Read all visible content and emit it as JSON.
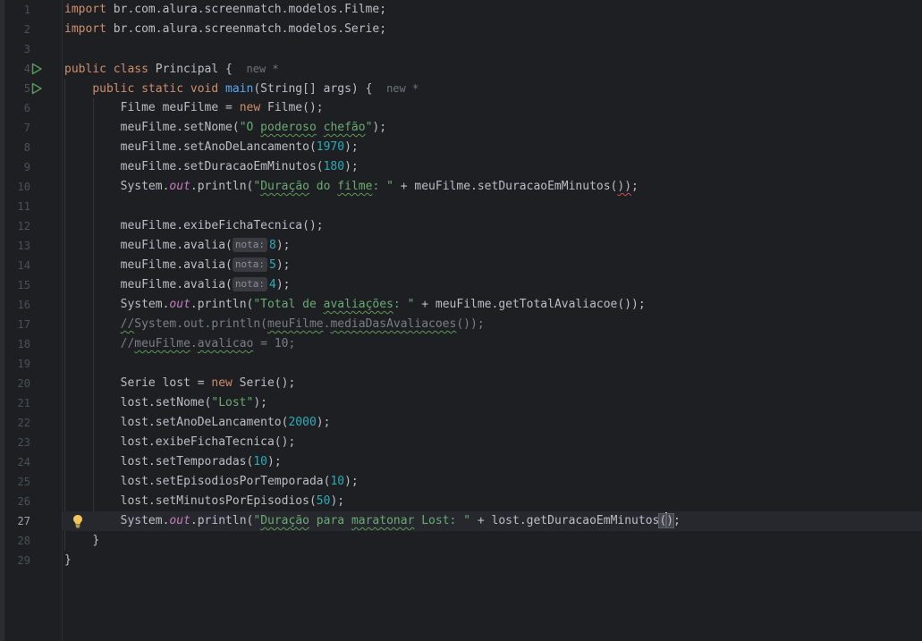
{
  "gutter": {
    "line_numbers": [
      "1",
      "2",
      "3",
      "4",
      "5",
      "6",
      "7",
      "8",
      "9",
      "10",
      "11",
      "12",
      "13",
      "14",
      "15",
      "16",
      "17",
      "18",
      "19",
      "20",
      "21",
      "22",
      "23",
      "24",
      "25",
      "26",
      "27",
      "28",
      "29"
    ],
    "current_line": "27"
  },
  "hints": {
    "new_label": "new *"
  },
  "code": {
    "l1a": "import",
    "l1b": " br.com.alura.screenmatch.modelos.Filme;",
    "l2a": "import",
    "l2b": " br.com.alura.screenmatch.modelos.Serie;",
    "l4a": "public class",
    "l4b": " Principal {",
    "l5a": "public static void",
    "l5b": "main",
    "l5c": "(String[] args) {",
    "l6a": "Filme meuFilme = ",
    "l6b": "new",
    "l6c": " Filme();",
    "l7a": "meuFilme.setNome(",
    "l7b": "\"O ",
    "l7c": "poderoso",
    "l7d": " ",
    "l7e": "chefão",
    "l7f": "\"",
    "l7g": ");",
    "l8a": "meuFilme.setAnoDeLancamento(",
    "l8b": "1970",
    "l8c": ");",
    "l9a": "meuFilme.setDuracaoEmMinutos(",
    "l9b": "180",
    "l9c": ");",
    "l10a": "System.",
    "l10b": "out",
    "l10c": ".println(",
    "l10d": "\"",
    "l10e": "Duração",
    "l10f": " do ",
    "l10g": "filme",
    "l10h": ": \"",
    "l10i": " + meuFilme.setDuracaoEmMinutos(",
    "l10j": "))",
    "l10k": ";",
    "l12a": "meuFilme.exibeFichaTecnica();",
    "l13a": "meuFilme.avalia(",
    "l13b": "nota:",
    "l13c": "8",
    "l13d": ");",
    "l14a": "meuFilme.avalia(",
    "l14b": "nota:",
    "l14c": "5",
    "l14d": ");",
    "l15a": "meuFilme.avalia(",
    "l15b": "nota:",
    "l15c": "4",
    "l15d": ");",
    "l16a": "System.",
    "l16b": "out",
    "l16c": ".println(",
    "l16d": "\"Total de ",
    "l16e": "avaliações",
    "l16f": ": \"",
    "l16g": " + meuFilme.getTotalAvaliacoe());",
    "l17a": "//",
    "l17b": "System.out.println(",
    "l17c": "meuFilme",
    "l17d": ".",
    "l17e": "mediaDasAvaliacoes",
    "l17f": "());",
    "l18a": "//",
    "l18b": "meuFilme",
    "l18c": ".",
    "l18d": "avalicao",
    "l18e": " = 10;",
    "l20a": "Serie lost = ",
    "l20b": "new",
    "l20c": " Serie();",
    "l21a": "lost.setNome(",
    "l21b": "\"Lost\"",
    "l21c": ");",
    "l22a": "lost.setAnoDeLancamento(",
    "l22b": "2000",
    "l22c": ");",
    "l23a": "lost.exibeFichaTecnica();",
    "l24a": "lost.setTemporadas(",
    "l24b": "10",
    "l24c": ");",
    "l25a": "lost.setEpisodiosPorTemporada(",
    "l25b": "10",
    "l25c": ");",
    "l26a": "lost.setMinutosPorEpisodios(",
    "l26b": "50",
    "l26c": ");",
    "l27a": "System.",
    "l27b": "out",
    "l27c": ".println(",
    "l27d": "\"",
    "l27e": "Duração",
    "l27f": " para ",
    "l27g": "maratonar",
    "l27h": " Lost: \"",
    "l27i": " + lost.getDuracaoEmMinutos",
    "l27j": "(",
    "l27k": ")",
    "l27l": ";",
    "l28a": "}",
    "l29a": "}"
  },
  "colors": {
    "background": "#1e1f22",
    "keyword": "#cf8e6d",
    "string": "#6aab73",
    "number": "#2aacb8",
    "method_decl": "#56a8f5",
    "static_field": "#c77dbb",
    "comment": "#7a7e85"
  },
  "icons": {
    "run": "run-gutter-icon",
    "intention": "lightbulb-icon"
  }
}
